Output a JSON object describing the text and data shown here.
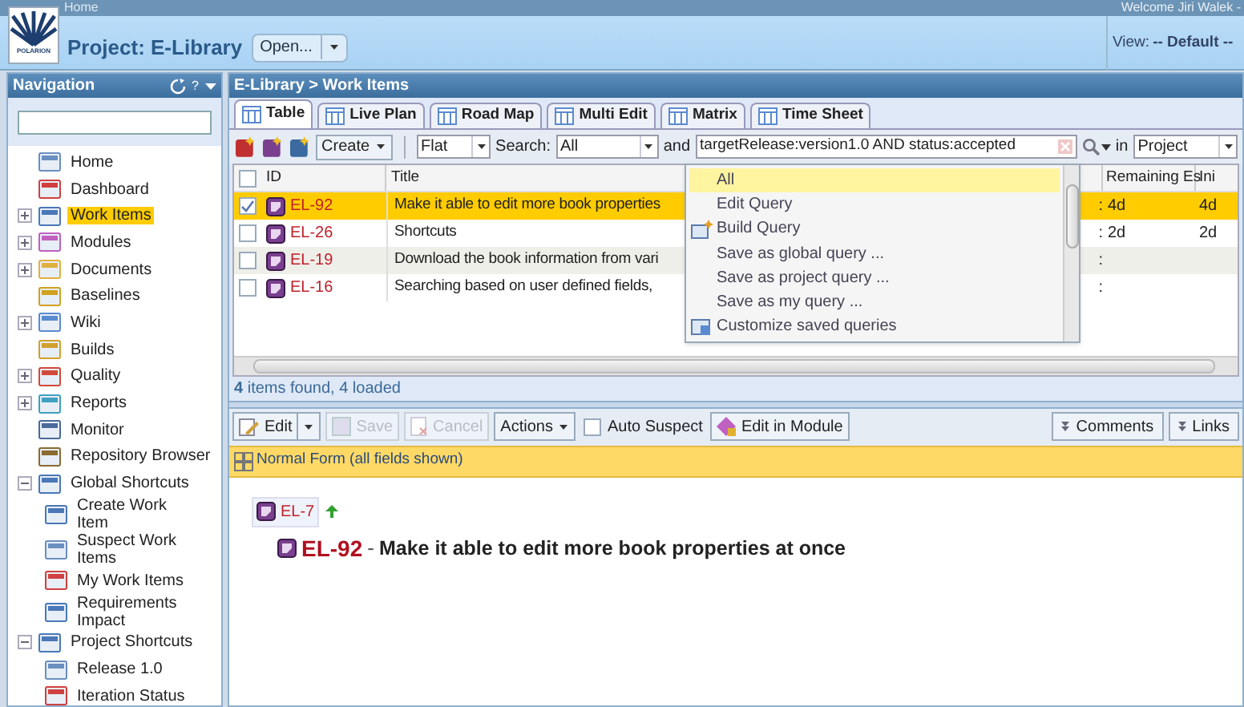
{
  "header": {
    "breadcrumb": "Home",
    "logo_text": "POLARION",
    "project": "Project: E-Library",
    "open_button": "Open...",
    "welcome": "Welcome Jiri Walek -",
    "view_label": "View:",
    "view_value": "-- Default --"
  },
  "navigation": {
    "title": "Navigation",
    "help": "?",
    "items": [
      {
        "label": "Home",
        "selected": false
      },
      {
        "label": "Dashboard",
        "selected": false
      },
      {
        "label": "Work Items",
        "selected": true,
        "expanded": false
      },
      {
        "label": "Modules",
        "selected": false,
        "expanded": false
      },
      {
        "label": "Documents",
        "selected": false,
        "expanded": false
      },
      {
        "label": "Baselines",
        "selected": false
      },
      {
        "label": "Wiki",
        "selected": false,
        "expanded": false
      },
      {
        "label": "Builds",
        "selected": false
      },
      {
        "label": "Quality",
        "selected": false,
        "expanded": false
      },
      {
        "label": "Reports",
        "selected": false,
        "expanded": false
      },
      {
        "label": "Monitor",
        "selected": false
      },
      {
        "label": "Repository Browser",
        "selected": false
      },
      {
        "label": "Global Shortcuts",
        "selected": false,
        "expanded": true,
        "children": [
          {
            "label": "Create Work Item",
            "selected": false
          },
          {
            "label": "Suspect Work Items",
            "selected": false
          },
          {
            "label": "My Work Items",
            "selected": false
          },
          {
            "label": "Requirements Impact",
            "selected": false
          }
        ]
      },
      {
        "label": "Project Shortcuts",
        "selected": false,
        "expanded": true,
        "children": [
          {
            "label": "Release 1.0",
            "selected": false
          },
          {
            "label": "Iteration Status",
            "selected": false
          }
        ]
      }
    ]
  },
  "main": {
    "title": "E-Library > Work Items",
    "tabs": [
      {
        "label": "Table",
        "selected": true
      },
      {
        "label": "Live Plan",
        "selected": false
      },
      {
        "label": "Road Map",
        "selected": false
      },
      {
        "label": "Multi Edit",
        "selected": false
      },
      {
        "label": "Matrix",
        "selected": false
      },
      {
        "label": "Time Sheet",
        "selected": false
      }
    ],
    "toolbar": {
      "create": "Create",
      "mode": "Flat",
      "search_label": "Search:",
      "search_value": "All",
      "and_label": "and",
      "query": "targetRelease:version1.0 AND status:accepted",
      "in_label": "in",
      "scope": "Project"
    },
    "table": {
      "all_checked": false,
      "columns": [
        "ID",
        "Title",
        "Remaining Es",
        "Ini"
      ],
      "rows": [
        {
          "checked": true,
          "selected": true,
          "id": "EL-92",
          "title": "Make it able to edit more book properties",
          "column_3": ":",
          "remaining": "4d",
          "initial": "4d"
        },
        {
          "checked": false,
          "selected": false,
          "id": "EL-26",
          "title": "Shortcuts",
          "column_3": ":",
          "remaining": "2d",
          "initial": "2d"
        },
        {
          "checked": false,
          "selected": false,
          "id": "EL-19",
          "title": "Download the book information from vari",
          "column_3": ":"
        },
        {
          "checked": false,
          "selected": false,
          "id": "EL-16",
          "title": "Searching based on user defined fields,",
          "column_3": ":"
        }
      ]
    },
    "query_menu": [
      {
        "label": "All",
        "selected": true,
        "kind": "plain"
      },
      {
        "label": "Edit Query",
        "selected": false,
        "kind": "plain"
      },
      {
        "label": "Build Query",
        "selected": false,
        "kind": "build"
      },
      {
        "label": "Save as global query ...",
        "selected": false,
        "kind": "plain"
      },
      {
        "label": "Save as project query ...",
        "selected": false,
        "kind": "plain"
      },
      {
        "label": "Save as my query ...",
        "selected": false,
        "kind": "plain"
      },
      {
        "label": "Customize saved queries",
        "selected": false,
        "kind": "customize"
      }
    ],
    "status": "**4** items found, 4 loaded"
  },
  "detail": {
    "toolbar": [
      {
        "kind": "split",
        "label": "Edit",
        "disabled": false
      },
      {
        "kind": "button",
        "label": "Save",
        "disabled": true
      },
      {
        "kind": "button",
        "label": "Cancel",
        "disabled": true
      },
      {
        "kind": "menu",
        "label": "Actions",
        "disabled": false
      },
      {
        "kind": "checkbox",
        "label": "Auto Suspect",
        "checked": false
      },
      {
        "kind": "button",
        "label": "Edit in Module",
        "disabled": false
      }
    ],
    "right_buttons": [
      "Comments",
      "Links"
    ],
    "form_bar": "Normal Form (all fields shown)",
    "parent": "EL-7",
    "item_id": "EL-92",
    "item_separator": "-",
    "item_title": "Make it able to edit more book properties at once"
  }
}
